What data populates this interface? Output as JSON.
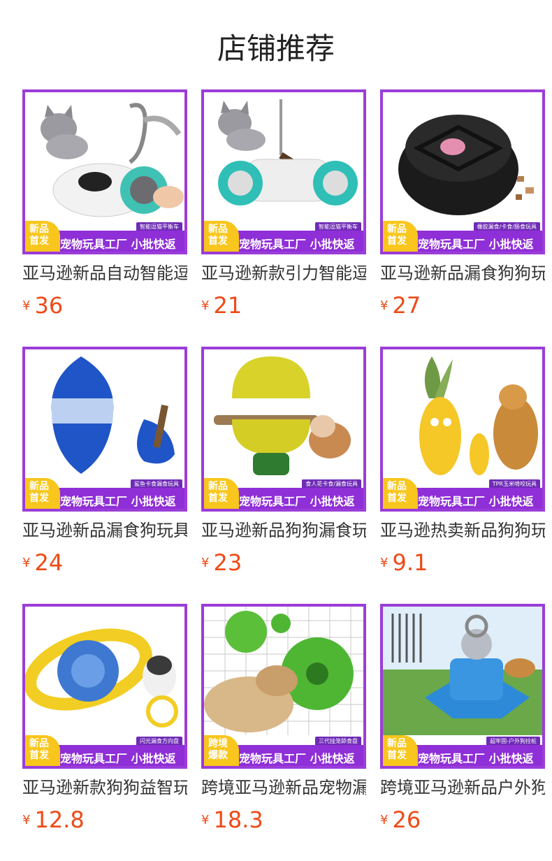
{
  "header": {
    "title": "店铺推荐"
  },
  "strip_text": "宠物玩具工厂 小批快返",
  "currency": "¥",
  "colors": {
    "accent": "#8f2fd7",
    "badge": "#f8c61c",
    "price": "#ee4a16"
  },
  "products": [
    {
      "name": "亚马逊新品自动智能逗猫平衡车",
      "price": "36",
      "badge": "新品\n首发",
      "subtag": "智能逗猫平衡车",
      "icon": "cat-toy-car-icon"
    },
    {
      "name": "亚马逊新款引力智能逗猫车",
      "price": "21",
      "badge": "新品\n首发",
      "subtag": "智能逗猫平衡车",
      "icon": "cat-toy-car-icon"
    },
    {
      "name": "亚马逊新品漏食狗狗玩具",
      "price": "27",
      "badge": "新品\n首发",
      "subtag": "橡胶漏食/卡食/肠食玩具",
      "icon": "rubber-tire-toy-icon"
    },
    {
      "name": "亚马逊新品漏食狗玩具",
      "price": "24",
      "badge": "新品\n首发",
      "subtag": "鲨鱼卡食漏食玩具",
      "icon": "shark-toy-icon"
    },
    {
      "name": "亚马逊新品狗狗漏食玩具",
      "price": "23",
      "badge": "新品\n首发",
      "subtag": "食人花卡食/漏食玩具",
      "icon": "flower-feeder-toy-icon"
    },
    {
      "name": "亚马逊热卖新品狗狗玩具",
      "price": "9.1",
      "badge": "新品\n首发",
      "subtag": "TPR玉米啃咬玩具",
      "icon": "corn-chew-toy-icon"
    },
    {
      "name": "亚马逊新款狗狗益智玩具",
      "price": "12.8",
      "badge": "新品\n首发",
      "subtag": "闪光漏食方向盘",
      "icon": "ufo-feeder-toy-icon"
    },
    {
      "name": "跨境亚马逊新品宠物漏食盘",
      "price": "18.3",
      "badge": "跨境\n爆款",
      "subtag": "三代挂笼舔食盘",
      "icon": "lick-mat-icon"
    },
    {
      "name": "跨境亚马逊新品户外狗狗拴桩",
      "price": "26",
      "badge": "新品\n首发",
      "subtag": "超牢固-户外狗拴桩",
      "icon": "dog-tie-out-stake-icon"
    }
  ]
}
